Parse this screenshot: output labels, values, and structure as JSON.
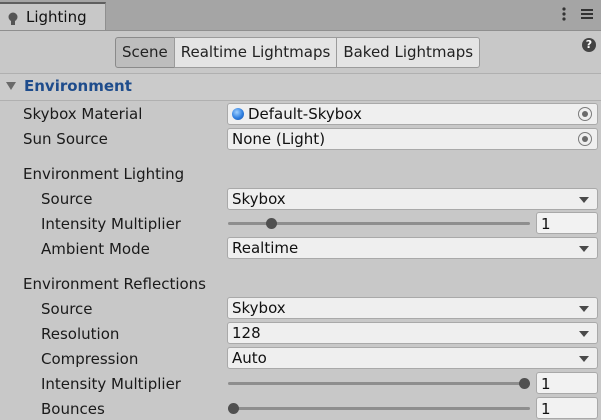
{
  "window": {
    "tab_title": "Lighting"
  },
  "toolbar": {
    "tabs": [
      "Scene",
      "Realtime Lightmaps",
      "Baked Lightmaps"
    ],
    "active_tab": "Scene",
    "help": "?"
  },
  "section": {
    "title": "Environment"
  },
  "skybox_material": {
    "label": "Skybox Material",
    "value": "Default-Skybox"
  },
  "sun_source": {
    "label": "Sun Source",
    "value": "None (Light)"
  },
  "env_lighting": {
    "header": "Environment Lighting",
    "source": {
      "label": "Source",
      "value": "Skybox"
    },
    "intensity": {
      "label": "Intensity Multiplier",
      "value": "1",
      "slider_fraction": 0.13
    },
    "ambient_mode": {
      "label": "Ambient Mode",
      "value": "Realtime"
    }
  },
  "env_reflections": {
    "header": "Environment Reflections",
    "source": {
      "label": "Source",
      "value": "Skybox"
    },
    "resolution": {
      "label": "Resolution",
      "value": "128"
    },
    "compression": {
      "label": "Compression",
      "value": "Auto"
    },
    "intensity": {
      "label": "Intensity Multiplier",
      "value": "1",
      "slider_fraction": 1.0
    },
    "bounces": {
      "label": "Bounces",
      "value": "1",
      "slider_fraction": 0.0
    }
  },
  "colors": {
    "section_title": "#1e4c8c",
    "panel_bg": "#c8c8c8"
  }
}
